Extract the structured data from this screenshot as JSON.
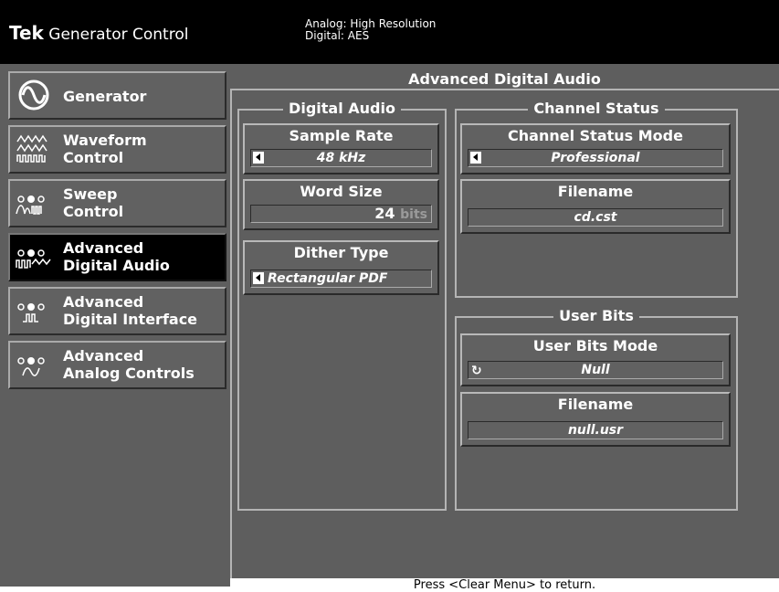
{
  "header": {
    "brand": "Tek",
    "title": "Generator Control",
    "signal_line1": "Analog: High Resolution",
    "signal_line2": "Digital: AES"
  },
  "sidebar": {
    "items": [
      {
        "label": "Generator",
        "icon": "sine-wave-icon"
      },
      {
        "label": "Waveform\nControl",
        "icon": "waveform-icon"
      },
      {
        "label": "Sweep\nControl",
        "icon": "sweep-icon"
      },
      {
        "label": "Advanced\nDigital Audio",
        "icon": "digital-audio-icon",
        "active": true
      },
      {
        "label": "Advanced\nDigital Interface",
        "icon": "digital-interface-icon"
      },
      {
        "label": "Advanced\nAnalog Controls",
        "icon": "analog-controls-icon"
      }
    ]
  },
  "main": {
    "title": "Advanced Digital Audio",
    "digital_audio": {
      "title": "Digital Audio",
      "sample_rate": {
        "label": "Sample Rate",
        "value": "48 kHz"
      },
      "word_size": {
        "label": "Word Size",
        "value": "24",
        "unit": "bits"
      },
      "dither_type": {
        "label": "Dither Type",
        "value": "Rectangular PDF"
      }
    },
    "channel_status": {
      "title": "Channel Status",
      "mode": {
        "label": "Channel Status Mode",
        "value": "Professional"
      },
      "filename": {
        "label": "Filename",
        "value": "cd.cst"
      }
    },
    "user_bits": {
      "title": "User Bits",
      "mode": {
        "label": "User Bits Mode",
        "value": "Null"
      },
      "filename": {
        "label": "Filename",
        "value": "null.usr"
      }
    }
  },
  "footer": {
    "text": "Press <Clear Menu> to return."
  },
  "colors": {
    "background": "#5e5e5e",
    "titlebar": "#000000",
    "active_item": "#000000"
  }
}
